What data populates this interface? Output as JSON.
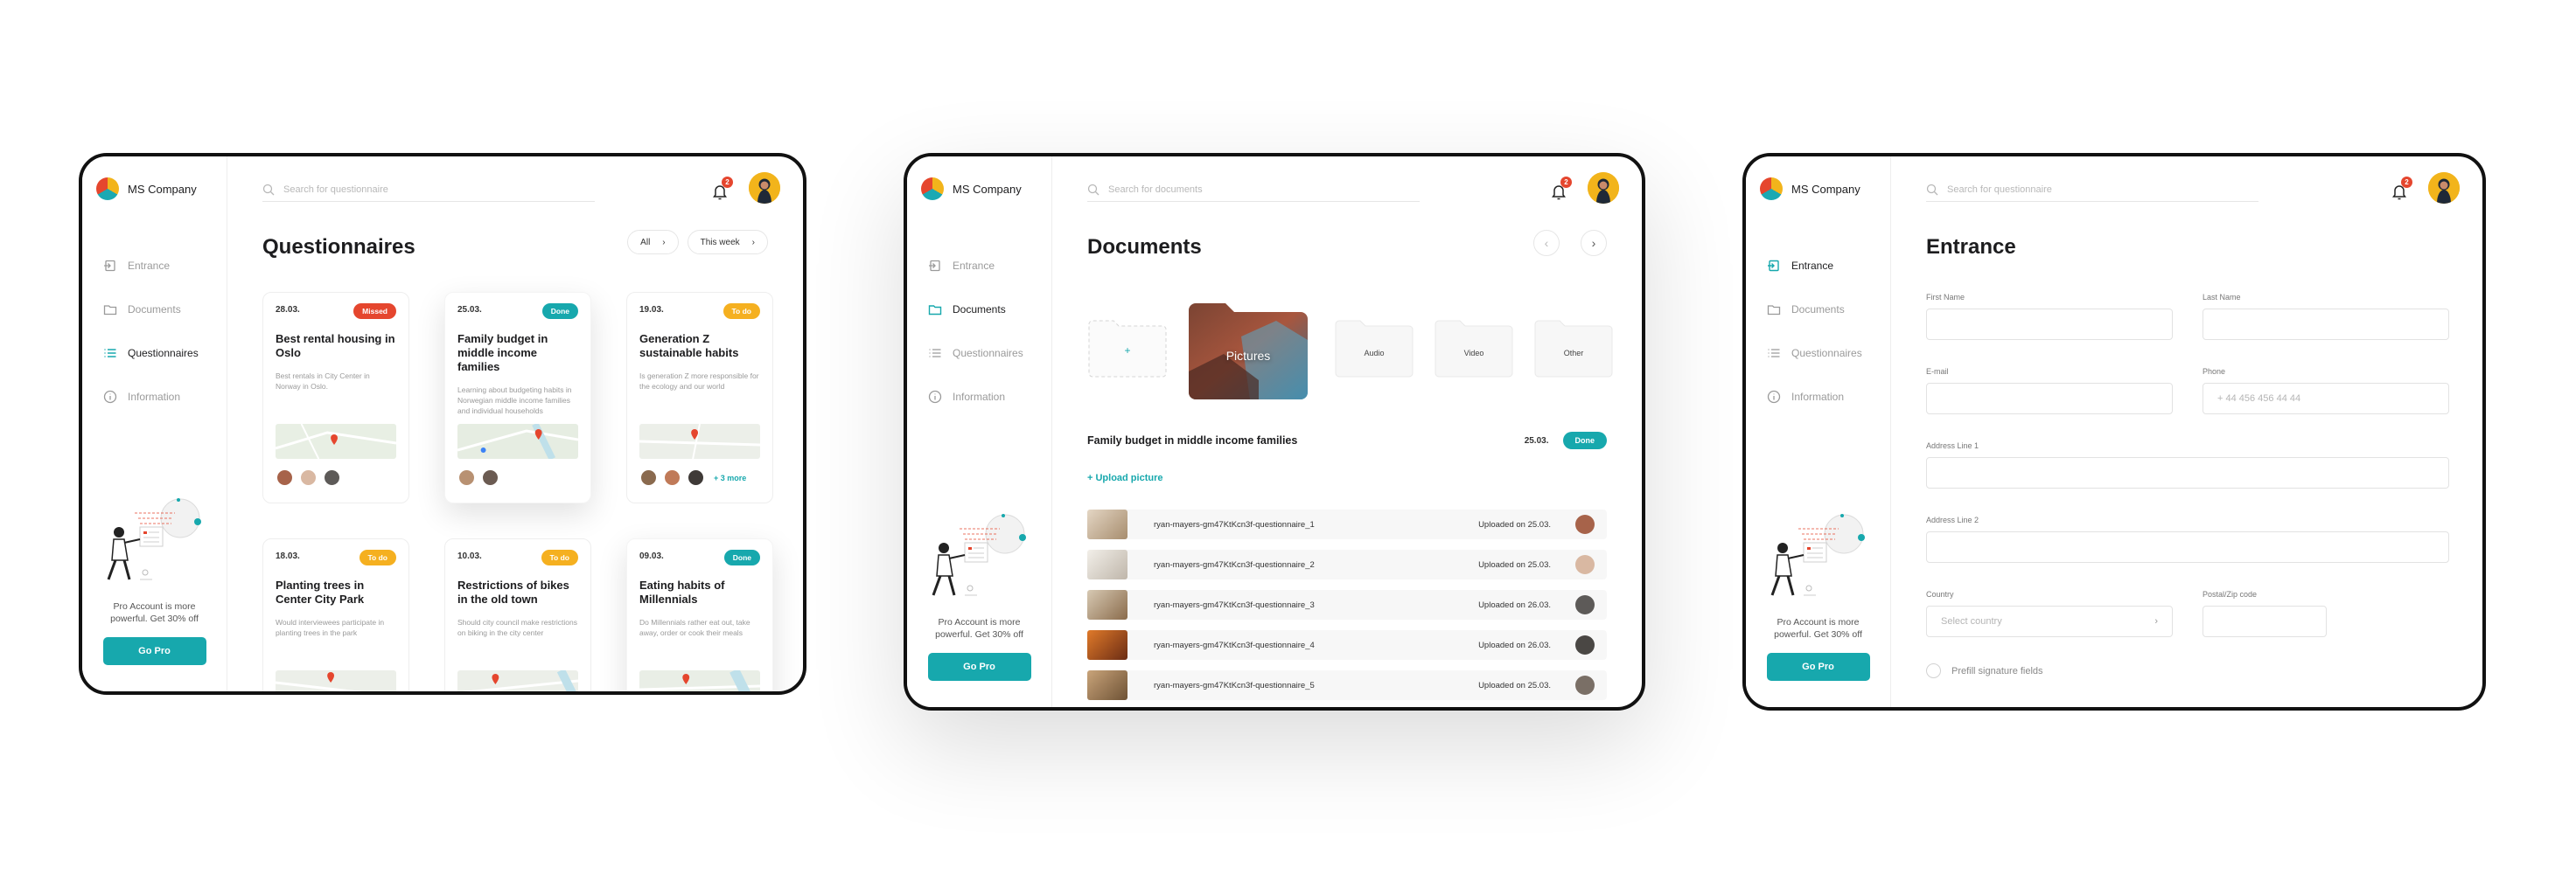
{
  "colors": {
    "accent": "#17a8ad",
    "missed": "#e5462e",
    "todo": "#f5b020",
    "done": "#17a8ad",
    "badge": "#e5462e"
  },
  "brand": {
    "company": "MS Company",
    "logo_icon": "ms-company-logo"
  },
  "sidebar": {
    "items": [
      {
        "label": "Entrance",
        "icon": "entrance-icon"
      },
      {
        "label": "Documents",
        "icon": "folder-icon"
      },
      {
        "label": "Questionnaires",
        "icon": "list-icon"
      },
      {
        "label": "Information",
        "icon": "info-icon"
      }
    ],
    "promo_text": "Pro Account is more powerful. Get 30% off",
    "go_pro": "Go Pro"
  },
  "notifications": {
    "count": "2"
  },
  "screen1": {
    "search_placeholder": "Search for questionnaire",
    "title": "Questionnaires",
    "filter_all": "All",
    "filter_week": "This week",
    "cards": [
      {
        "date": "28.03.",
        "status": "Missed",
        "title": "Best rental housing in Oslo",
        "desc": "Best rentals in City Center in Norway in Oslo."
      },
      {
        "date": "25.03.",
        "status": "Done",
        "title": "Family budget in middle income families",
        "desc": "Learning about budgeting habits in Norwegian middle income families and individual households"
      },
      {
        "date": "19.03.",
        "status": "To do",
        "title": "Generation Z sustainable habits",
        "desc": "Is generation Z more responsible for the ecology and our world",
        "more": "+ 3 more"
      },
      {
        "date": "18.03.",
        "status": "To do",
        "title": "Planting trees in Center City Park",
        "desc": "Would interviewees participate in planting trees in the park"
      },
      {
        "date": "10.03.",
        "status": "To do",
        "title": "Restrictions of bikes in the old town",
        "desc": "Should city council make restrictions on biking in the city center"
      },
      {
        "date": "09.03.",
        "status": "Done",
        "title": "Eating habits of Millennials",
        "desc": "Do Millennials rather eat out, take away, order or cook their meals"
      }
    ]
  },
  "screen2": {
    "search_placeholder": "Search for documents",
    "title": "Documents",
    "folders": [
      "+",
      "Pictures",
      "Audio",
      "Video",
      "Other"
    ],
    "doc_title": "Family budget in middle income families",
    "doc_date": "25.03.",
    "doc_status": "Done",
    "upload_label": "+ Upload picture",
    "files": [
      {
        "name": "ryan-mayers-gm47KtKcn3f-questionnaire_1",
        "uploaded": "Uploaded on 25.03."
      },
      {
        "name": "ryan-mayers-gm47KtKcn3f-questionnaire_2",
        "uploaded": "Uploaded on 25.03."
      },
      {
        "name": "ryan-mayers-gm47KtKcn3f-questionnaire_3",
        "uploaded": "Uploaded on 26.03."
      },
      {
        "name": "ryan-mayers-gm47KtKcn3f-questionnaire_4",
        "uploaded": "Uploaded on 26.03."
      },
      {
        "name": "ryan-mayers-gm47KtKcn3f-questionnaire_5",
        "uploaded": "Uploaded on 25.03."
      }
    ]
  },
  "screen3": {
    "search_placeholder": "Search for questionnaire",
    "title": "Entrance",
    "first_name": "First Name",
    "last_name": "Last Name",
    "email": "E-mail",
    "phone": "Phone",
    "phone_placeholder": "+ 44 456 456 44 44",
    "address1": "Address Line 1",
    "address2": "Address Line 2",
    "country": "Country",
    "country_placeholder": "Select country",
    "postal": "Postal/Zip code",
    "prefill": "Prefill signature fields"
  }
}
